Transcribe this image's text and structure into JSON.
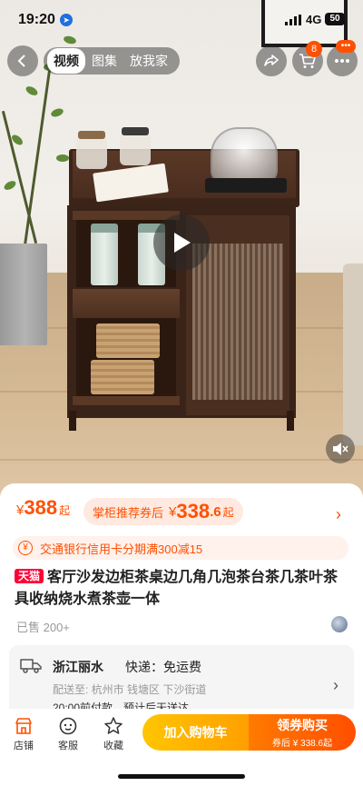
{
  "status_bar": {
    "time": "19:20",
    "network": "4G",
    "battery": "50"
  },
  "media_tabs": [
    {
      "label": "视频",
      "active": true
    },
    {
      "label": "图集",
      "active": false
    },
    {
      "label": "放我家",
      "active": false
    }
  ],
  "cart_badge": "8",
  "more_badge": "•••",
  "price": {
    "currency": "¥",
    "value": "388",
    "suffix": "起"
  },
  "coupon_price": {
    "label": "掌柜推荐券后",
    "currency": "¥",
    "int": "338",
    "dec": ".6",
    "suffix": "起"
  },
  "promo": {
    "text": "交通银行信用卡分期满300减15"
  },
  "product": {
    "tag": "天猫",
    "title": "客厅沙发边柜茶桌边几角几泡茶台茶几茶叶茶具收纳烧水煮茶壶一体"
  },
  "sold": "已售 200+",
  "shipping": {
    "from": "浙江丽水",
    "fee": "快递：免运费",
    "to": "配送至: 杭州市 钱塘区 下沙街道",
    "time": "20:00前付款，预计后天送达"
  },
  "bottom_bar": {
    "shop": "店铺",
    "service": "客服",
    "favorite": "收藏",
    "add_cart": "加入购物车",
    "buy_main": "领券购买",
    "buy_sub": "券后 ¥ 338.6起"
  },
  "colors": {
    "accent": "#ff5000",
    "tmall": "#ff0036",
    "cart_btn": "#ffb000"
  }
}
